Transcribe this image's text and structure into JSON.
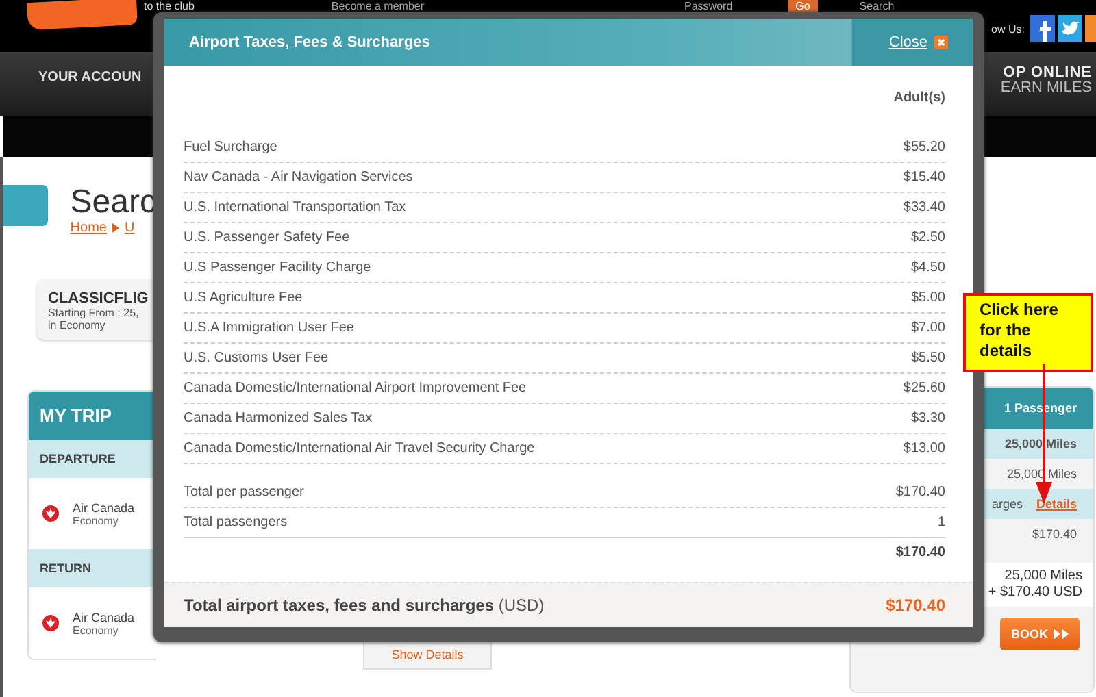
{
  "header": {
    "tagline": "to the club",
    "member_link": "Become a member",
    "password_label": "Password",
    "go_button": "Go",
    "search_label": "Search",
    "follow_label": "ow Us:"
  },
  "nav": {
    "account": "YOUR ACCOUN",
    "promo_line1": "OP ONLINE",
    "promo_line2": "EARN MILES"
  },
  "page": {
    "heading": "Searc",
    "breadcrumb": [
      "Home",
      "U"
    ]
  },
  "fare_card": {
    "title": "CLASSICFLIG",
    "line1": "Starting From : 25,",
    "line2": "in Economy"
  },
  "my_trip": {
    "title": "MY TRIP",
    "segments": [
      {
        "heading": "DEPARTURE",
        "airline": "Air Canada",
        "cabin": "Economy"
      },
      {
        "heading": "RETURN",
        "airline": "Air Canada",
        "cabin": "Economy"
      }
    ],
    "show_details": "Show Details"
  },
  "summary": {
    "passengers": "1  Passenger",
    "rows": [
      {
        "kind": "highlight",
        "text": "25,000 Miles"
      },
      {
        "kind": "plain",
        "text": "25,000 Miles"
      },
      {
        "kind": "link",
        "text": "arges",
        "link": "Details"
      },
      {
        "kind": "plain",
        "text": "$170.40"
      }
    ],
    "total_miles": "25,000  Miles",
    "total_cash": "+ $170.40 USD",
    "book_button": "BOOK"
  },
  "callout": {
    "text": "Click here for the details"
  },
  "modal": {
    "title": "Airport Taxes, Fees & Surcharges",
    "close": "Close",
    "column": "Adult(s)",
    "fees": [
      {
        "label": "Fuel Surcharge",
        "value": "$55.20"
      },
      {
        "label": "Nav Canada - Air Navigation Services",
        "value": "$15.40"
      },
      {
        "label": "U.S. International Transportation Tax",
        "value": "$33.40"
      },
      {
        "label": "U.S. Passenger Safety Fee",
        "value": "$2.50"
      },
      {
        "label": "U.S Passenger Facility Charge",
        "value": "$4.50"
      },
      {
        "label": "U.S Agriculture Fee",
        "value": "$5.00"
      },
      {
        "label": "U.S.A Immigration User Fee",
        "value": "$7.00"
      },
      {
        "label": "U.S. Customs User Fee",
        "value": "$5.50"
      },
      {
        "label": "Canada Domestic/International Airport Improvement Fee",
        "value": "$25.60"
      },
      {
        "label": "Canada Harmonized Sales Tax",
        "value": "$3.30"
      },
      {
        "label": "Canada Domestic/International Air Travel Security Charge",
        "value": "$13.00"
      }
    ],
    "totals": [
      {
        "kind": "line",
        "label": "Total per passenger",
        "value": "$170.40"
      },
      {
        "kind": "line",
        "label": "Total passengers",
        "value": "1"
      },
      {
        "kind": "sum",
        "value": "$170.40"
      }
    ],
    "footer_label": "**Total airport taxes, fees and surcharges** (USD)",
    "footer_value": "$170.40"
  }
}
